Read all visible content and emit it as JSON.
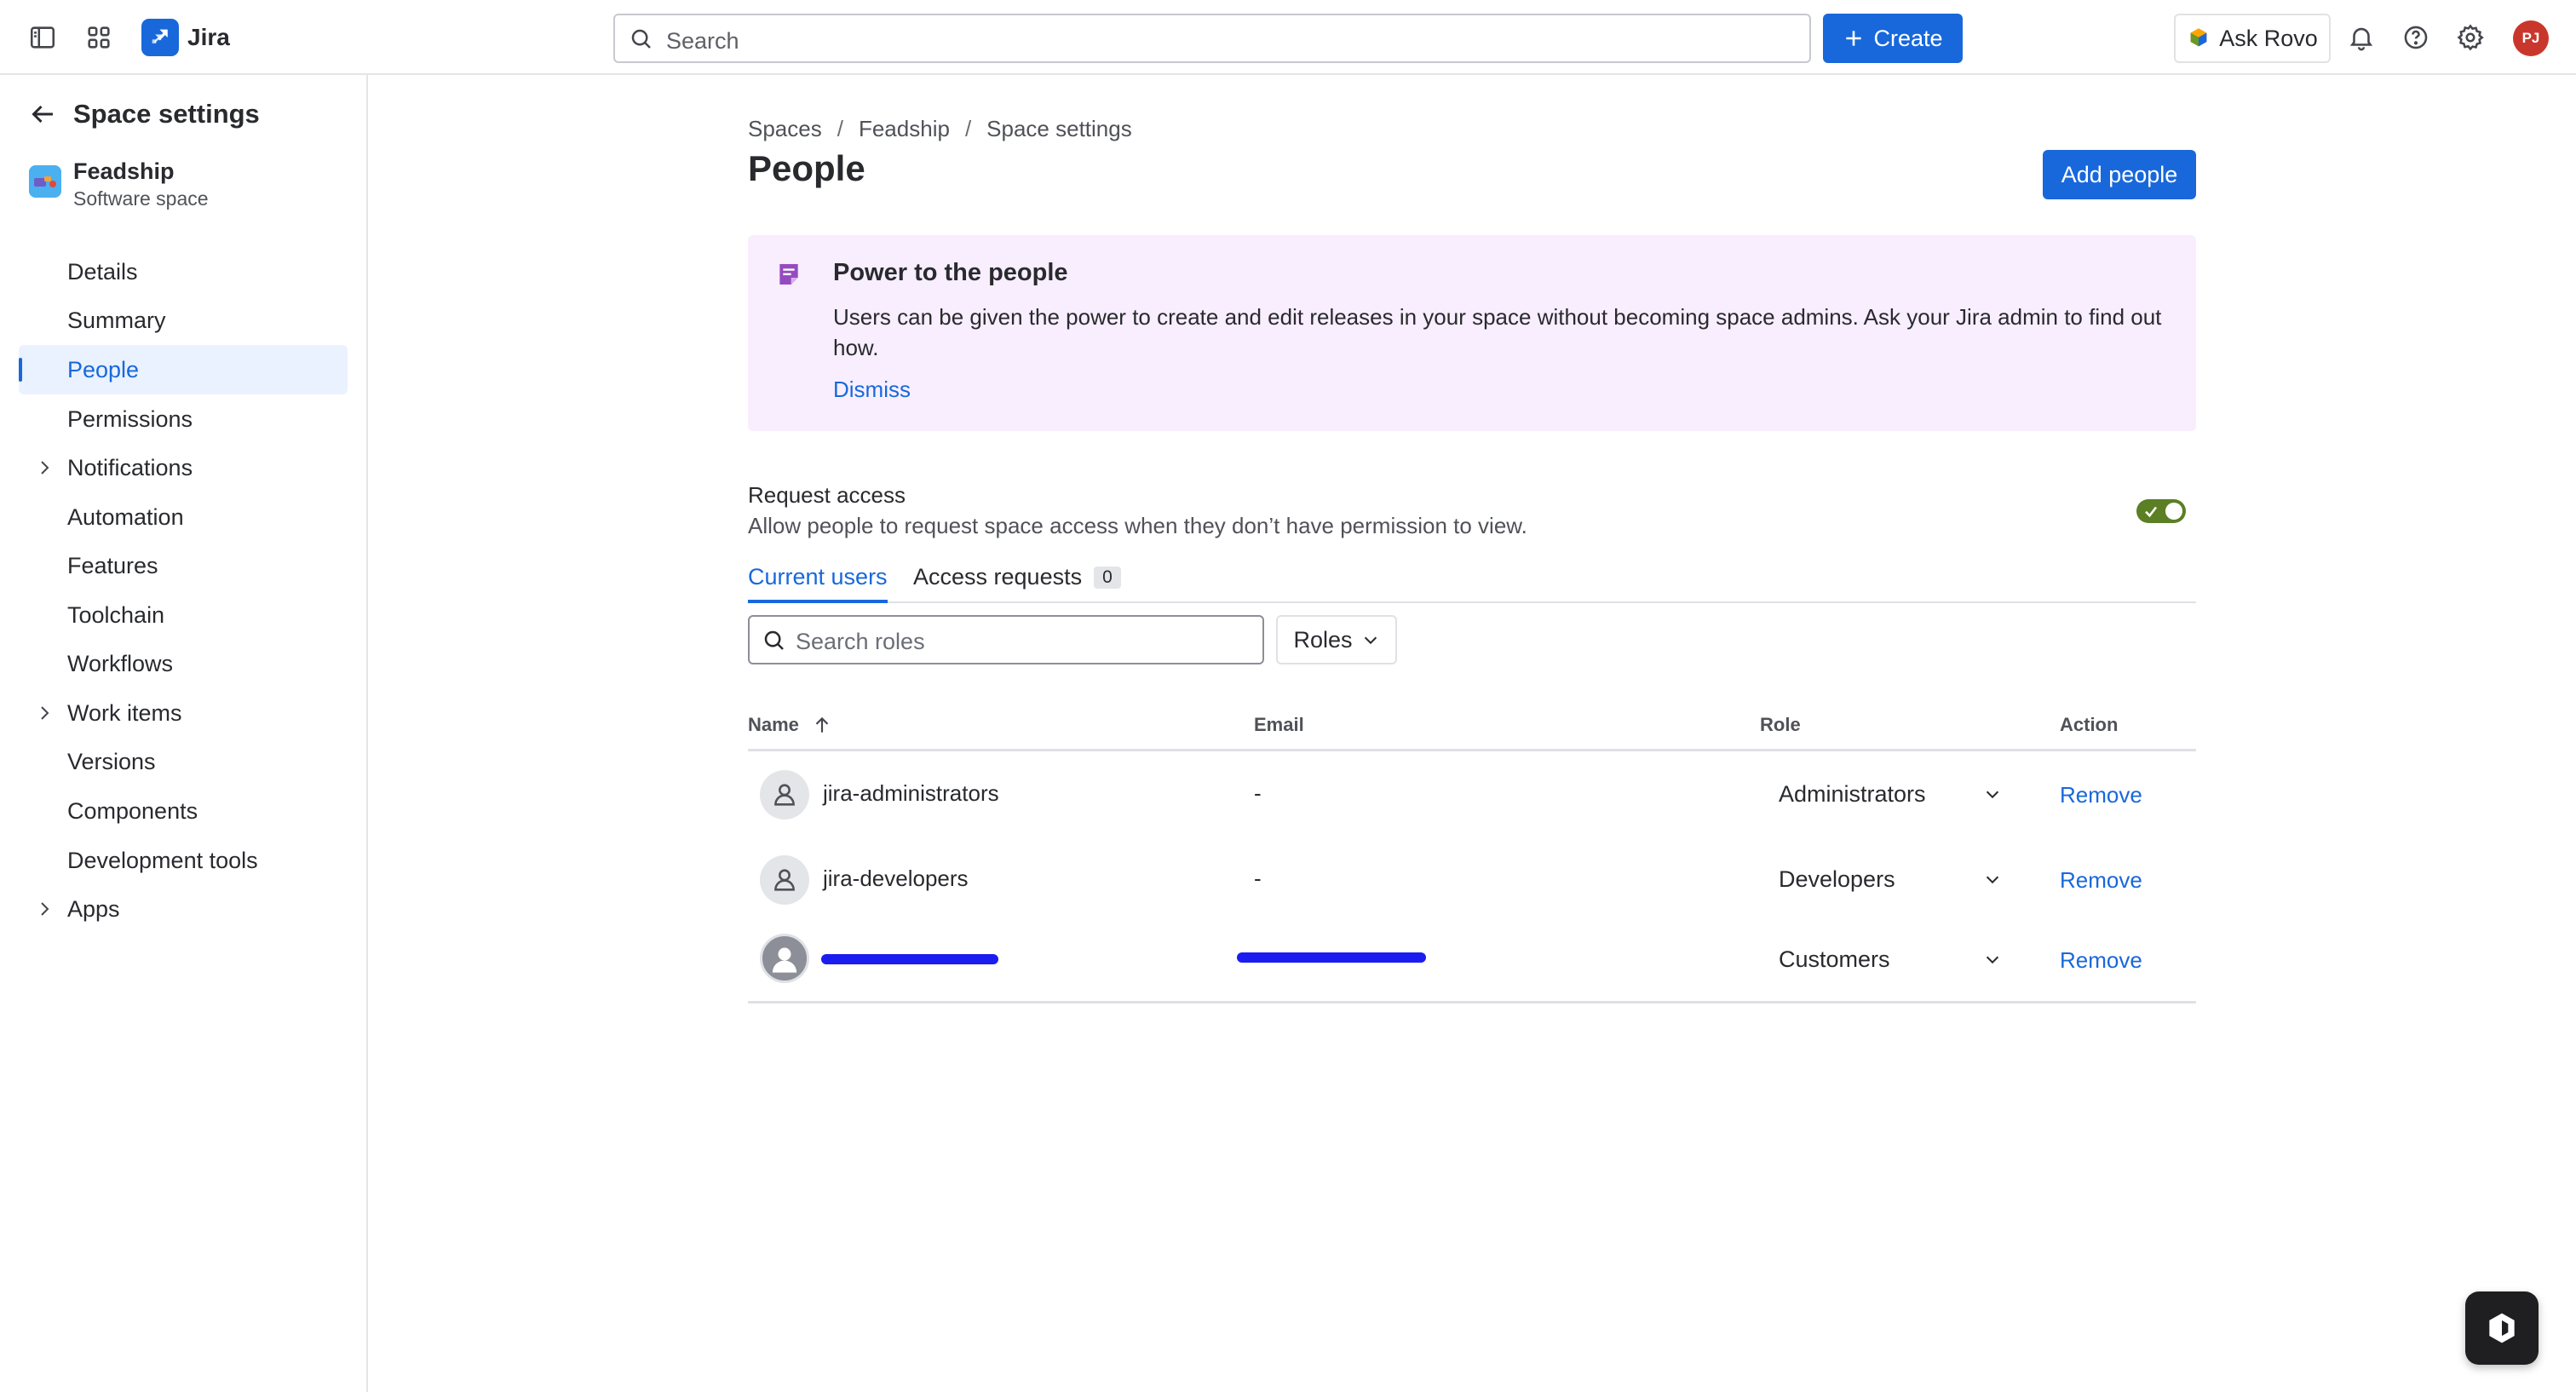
{
  "topbar": {
    "app_name": "Jira",
    "search_placeholder": "Search",
    "create_label": "Create",
    "ask_rovo_label": "Ask Rovo",
    "user_initials": "PJ",
    "brand_color": "#1868db"
  },
  "sidebar": {
    "title": "Space settings",
    "project": {
      "name": "Feadship",
      "type": "Software space"
    },
    "items": [
      {
        "label": "Details",
        "expandable": false,
        "active": false
      },
      {
        "label": "Summary",
        "expandable": false,
        "active": false
      },
      {
        "label": "People",
        "expandable": false,
        "active": true
      },
      {
        "label": "Permissions",
        "expandable": false,
        "active": false
      },
      {
        "label": "Notifications",
        "expandable": true,
        "active": false
      },
      {
        "label": "Automation",
        "expandable": false,
        "active": false
      },
      {
        "label": "Features",
        "expandable": false,
        "active": false
      },
      {
        "label": "Toolchain",
        "expandable": false,
        "active": false
      },
      {
        "label": "Workflows",
        "expandable": false,
        "active": false
      },
      {
        "label": "Work items",
        "expandable": true,
        "active": false
      },
      {
        "label": "Versions",
        "expandable": false,
        "active": false
      },
      {
        "label": "Components",
        "expandable": false,
        "active": false
      },
      {
        "label": "Development tools",
        "expandable": false,
        "active": false
      },
      {
        "label": "Apps",
        "expandable": true,
        "active": false
      }
    ]
  },
  "main": {
    "breadcrumb": [
      "Spaces",
      "Feadship",
      "Space settings"
    ],
    "breadcrumb_sep": "/",
    "title": "People",
    "add_people_label": "Add people",
    "banner": {
      "title": "Power to the people",
      "text": "Users can be given the power to create and edit releases in your space without becoming space admins. Ask your Jira admin to find out how.",
      "dismiss_label": "Dismiss",
      "background": "#f8eefe"
    },
    "request_access": {
      "title": "Request access",
      "description": "Allow people to request space access when they don’t have permission to view.",
      "enabled": true
    },
    "tabs": [
      {
        "label": "Current users",
        "active": true
      },
      {
        "label": "Access requests",
        "count": "0",
        "active": false
      }
    ],
    "search_roles_placeholder": "Search roles",
    "roles_filter_label": "Roles",
    "table": {
      "columns": {
        "name": "Name",
        "email": "Email",
        "role": "Role",
        "action": "Action"
      },
      "sort": "name-ascending",
      "rows": [
        {
          "name": "jira-administrators",
          "email": "-",
          "role": "Administrators",
          "action": "Remove",
          "avatar": "group-icon"
        },
        {
          "name": "jira-developers",
          "email": "-",
          "role": "Developers",
          "action": "Remove",
          "avatar": "group-icon"
        },
        {
          "name": "",
          "email": "",
          "role": "Customers",
          "action": "Remove",
          "avatar": "person-avatar",
          "redacted": true
        }
      ]
    }
  }
}
